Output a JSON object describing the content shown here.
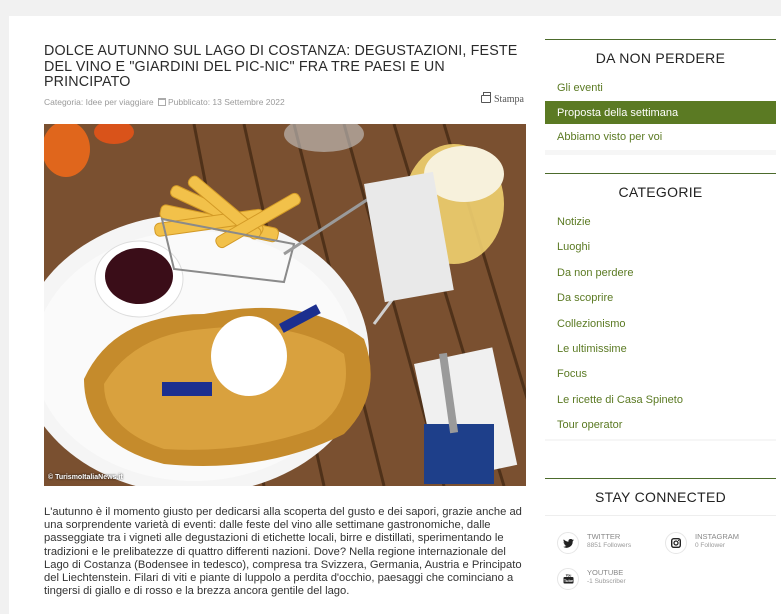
{
  "article": {
    "title": "DOLCE AUTUNNO SUL LAGO DI COSTANZA: DEGUSTAZIONI, FESTE DEL VINO E \"GIARDINI DEL PIC-NIC\" FRA TRE PAESI E UN PRINCIPATO",
    "category": "Categoria: Idee per viaggiare",
    "published": "Pubblicato: 13 Settembre 2022",
    "print_label": "Stampa",
    "photo_credit": "© TurismoItaliaNews.it",
    "body": "L'autunno è il momento giusto per dedicarsi alla scoperta del gusto e dei sapori, grazie anche ad una sorprendente varietà di eventi: dalle feste del vino alle settimane gastronomiche, dalle passeggiate tra i vigneti alle degustazioni di etichette locali, birre e distillati, sperimentando le tradizioni e le prelibatezze di quattro differenti nazioni. Dove? Nella regione internazionale del Lago di Costanza (Bodensee in tedesco), compresa tra Svizzera, Germania, Austria e Principato del Liechtenstein. Filari di viti e piante di luppolo a perdita d'occhio, paesaggi che cominciano a tingersi di giallo e di rosso e la brezza ancora gentile del lago."
  },
  "sidebar": {
    "da_non_perdere": {
      "title": "DA NON PERDERE",
      "items": [
        {
          "label": "Gli eventi",
          "active": false
        },
        {
          "label": "Proposta della settimana",
          "active": true
        },
        {
          "label": "Abbiamo visto per voi",
          "active": false
        }
      ]
    },
    "categorie": {
      "title": "CATEGORIE",
      "items": [
        "Notizie",
        "Luoghi",
        "Da non perdere",
        "Da scoprire",
        "Collezionismo",
        "Le ultimissime",
        "Focus",
        "Le ricette di Casa Spineto",
        "Tour operator"
      ]
    },
    "stay_connected": {
      "title": "STAY CONNECTED",
      "twitter": {
        "name": "TWITTER",
        "count": "8851 Followers",
        "icon": "twitter-icon"
      },
      "instagram": {
        "name": "INSTAGRAM",
        "count": "0 Follower",
        "icon": "instagram-icon"
      },
      "youtube": {
        "name": "YOUTUBE",
        "count": "-1 Subscriber",
        "icon": "youtube-icon"
      }
    }
  },
  "colors": {
    "accent": "#5b7a23",
    "title": "#2b2b2b",
    "background": "#f1f1f1"
  }
}
